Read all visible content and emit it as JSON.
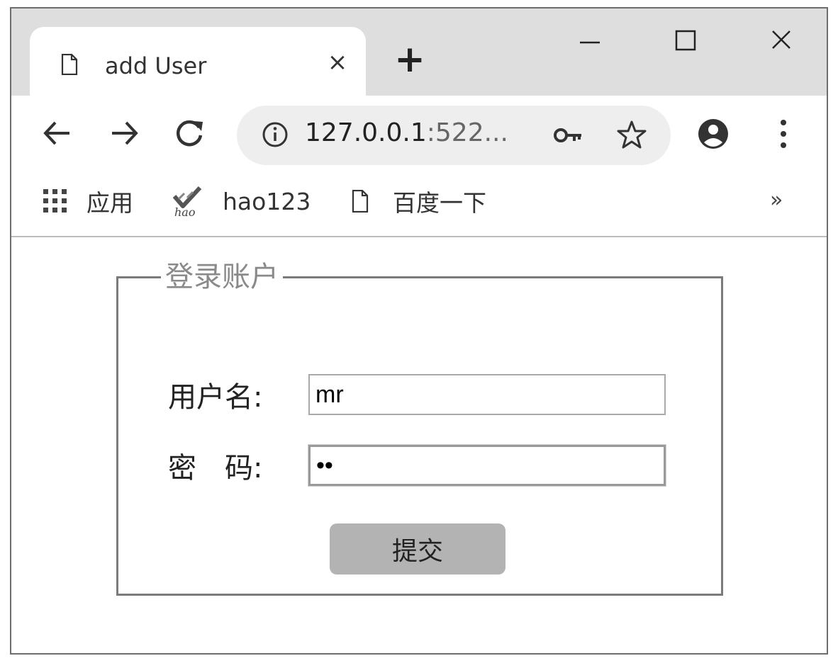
{
  "tab": {
    "title": "add User",
    "close_glyph": "×",
    "icon": "page-icon"
  },
  "new_tab": {
    "glyph": "+"
  },
  "window_controls": {
    "minimize": "minimize-icon",
    "maximize": "maximize-icon",
    "close": "close-icon"
  },
  "toolbar": {
    "back": "back-arrow-icon",
    "forward": "forward-arrow-icon",
    "reload": "reload-icon",
    "url_main": "127.0.0.1",
    "url_rest": ":522...",
    "site_info": "info-icon",
    "passwords": "key-icon",
    "bookmark": "star-icon",
    "profile": "account-icon",
    "menu": "more-vert-icon"
  },
  "bookmarks": {
    "items": [
      {
        "label": "应用",
        "icon": "apps-grid-icon"
      },
      {
        "label": "hao123",
        "icon": "hao123-icon"
      },
      {
        "label": "百度一下",
        "icon": "page-icon"
      }
    ],
    "overflow": "»"
  },
  "form": {
    "legend": "登录账户",
    "username_label": "用户名:",
    "username_value": "mr",
    "password_label": "密　码:",
    "password_value": "mr",
    "submit_label": "提交"
  }
}
